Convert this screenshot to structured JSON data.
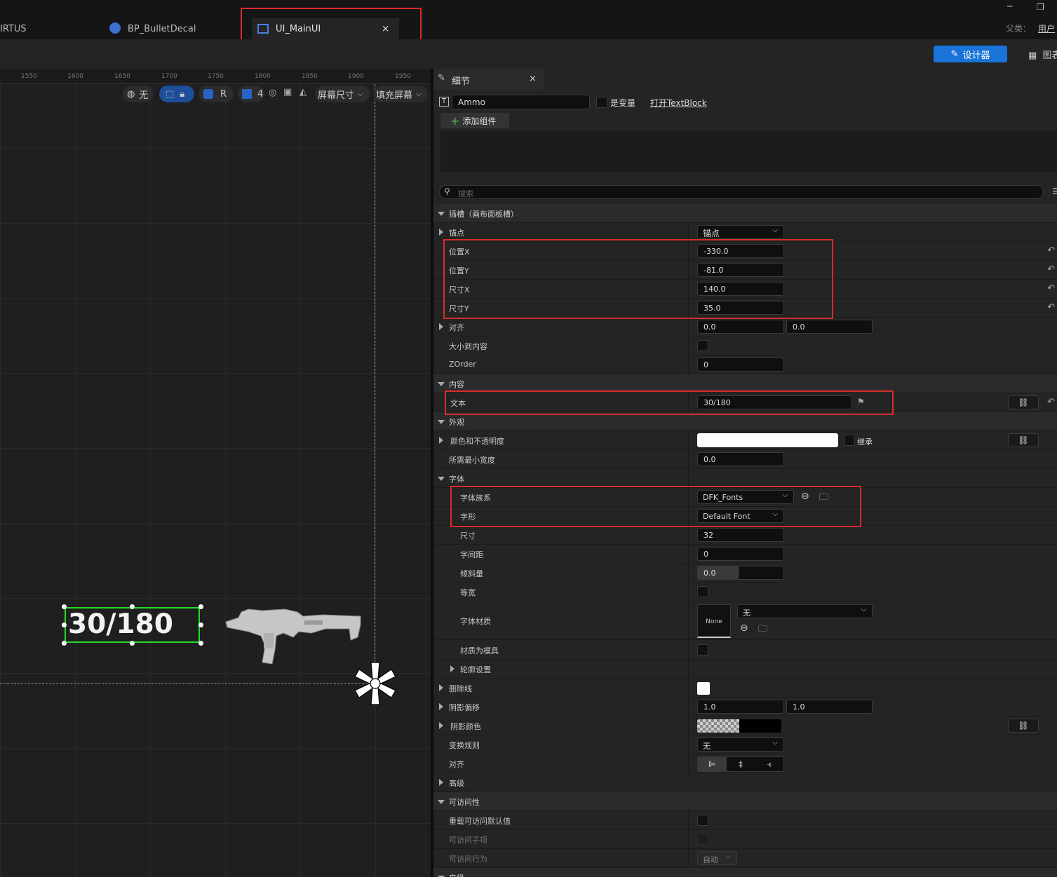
{
  "tabs": [
    {
      "label": "IRTUS"
    },
    {
      "label": "BP_BulletDecal"
    },
    {
      "label": "UI_MainUI",
      "close": "×"
    }
  ],
  "window": {
    "minimize": "─",
    "restore": "❐",
    "parent_label": "父类：",
    "parent_value": "用户"
  },
  "toolbar": {
    "designer_label": "设计器",
    "graph_label": "图表"
  },
  "ruler": {
    "ticks": [
      "1550",
      "1600",
      "1650",
      "1700",
      "1750",
      "1800",
      "1850",
      "1900",
      "1950"
    ]
  },
  "viewport_tools": {
    "world_label": "无",
    "r_label": "R",
    "grid_value": "4",
    "screen_size_label": "屏幕尺寸",
    "fill_screen_label": "填充屏幕"
  },
  "canvas": {
    "ammo_text": "30/180"
  },
  "details": {
    "tab_title": "细节",
    "tab_close": "×",
    "widget_name": "Ammo",
    "is_variable_label": "是变量",
    "open_link": "打开TextBlock",
    "add_component_label": "添加组件",
    "search_placeholder": "搜索",
    "slot_category": "插槽（画布面板槽）",
    "anchor_label": "锚点",
    "anchor_value": "锚点",
    "pos_x_label": "位置X",
    "pos_x_value": "-330.0",
    "pos_y_label": "位置Y",
    "pos_y_value": "-81.0",
    "size_x_label": "尺寸X",
    "size_x_value": "140.0",
    "size_y_label": "尺寸Y",
    "size_y_value": "35.0",
    "alignment_label": "对齐",
    "alignment_x": "0.0",
    "alignment_y": "0.0",
    "size_to_content_label": "大小到内容",
    "zorder_label": "ZOrder",
    "zorder_value": "0",
    "content_category": "内容",
    "text_label": "文本",
    "text_value": "30/180",
    "appearance_category": "外观",
    "color_label": "颜色和不透明度",
    "inherit_label": "继承",
    "min_width_label": "所需最小宽度",
    "min_width_value": "0.0",
    "font_category": "字体",
    "font_family_label": "字体族系",
    "font_family_value": "DFK_Fonts",
    "typeface_label": "字形",
    "typeface_value": "Default Font",
    "size_label": "尺寸",
    "size_value": "32",
    "letter_spacing_label": "字间距",
    "letter_spacing_value": "0",
    "skew_label": "倾斜量",
    "skew_value": "0.0",
    "monospace_label": "等宽",
    "font_material_label": "字体材质",
    "font_material_thumb": "None",
    "font_material_value": "无",
    "material_as_mask_label": "材质为模具",
    "outline_label": "轮廓设置",
    "strikethrough_label": "删除线",
    "shadow_offset_label": "阴影偏移",
    "shadow_offset_x": "1.0",
    "shadow_offset_y": "1.0",
    "shadow_color_label": "阴影颜色",
    "transform_policy_label": "变换规则",
    "transform_policy_value": "无",
    "justification_label": "对齐",
    "advanced_label": "高级",
    "accessibility_category": "可访问性",
    "override_accessible_label": "重载可访问默认值",
    "accessible_children_label": "可访问子项",
    "accessible_behavior_label": "可访问行为",
    "accessible_behavior_value": "自动",
    "bottom_category": "高级"
  },
  "colors": {
    "accent": "#1a73d9",
    "highlight": "#d82c2c",
    "selection": "#22dd22"
  }
}
